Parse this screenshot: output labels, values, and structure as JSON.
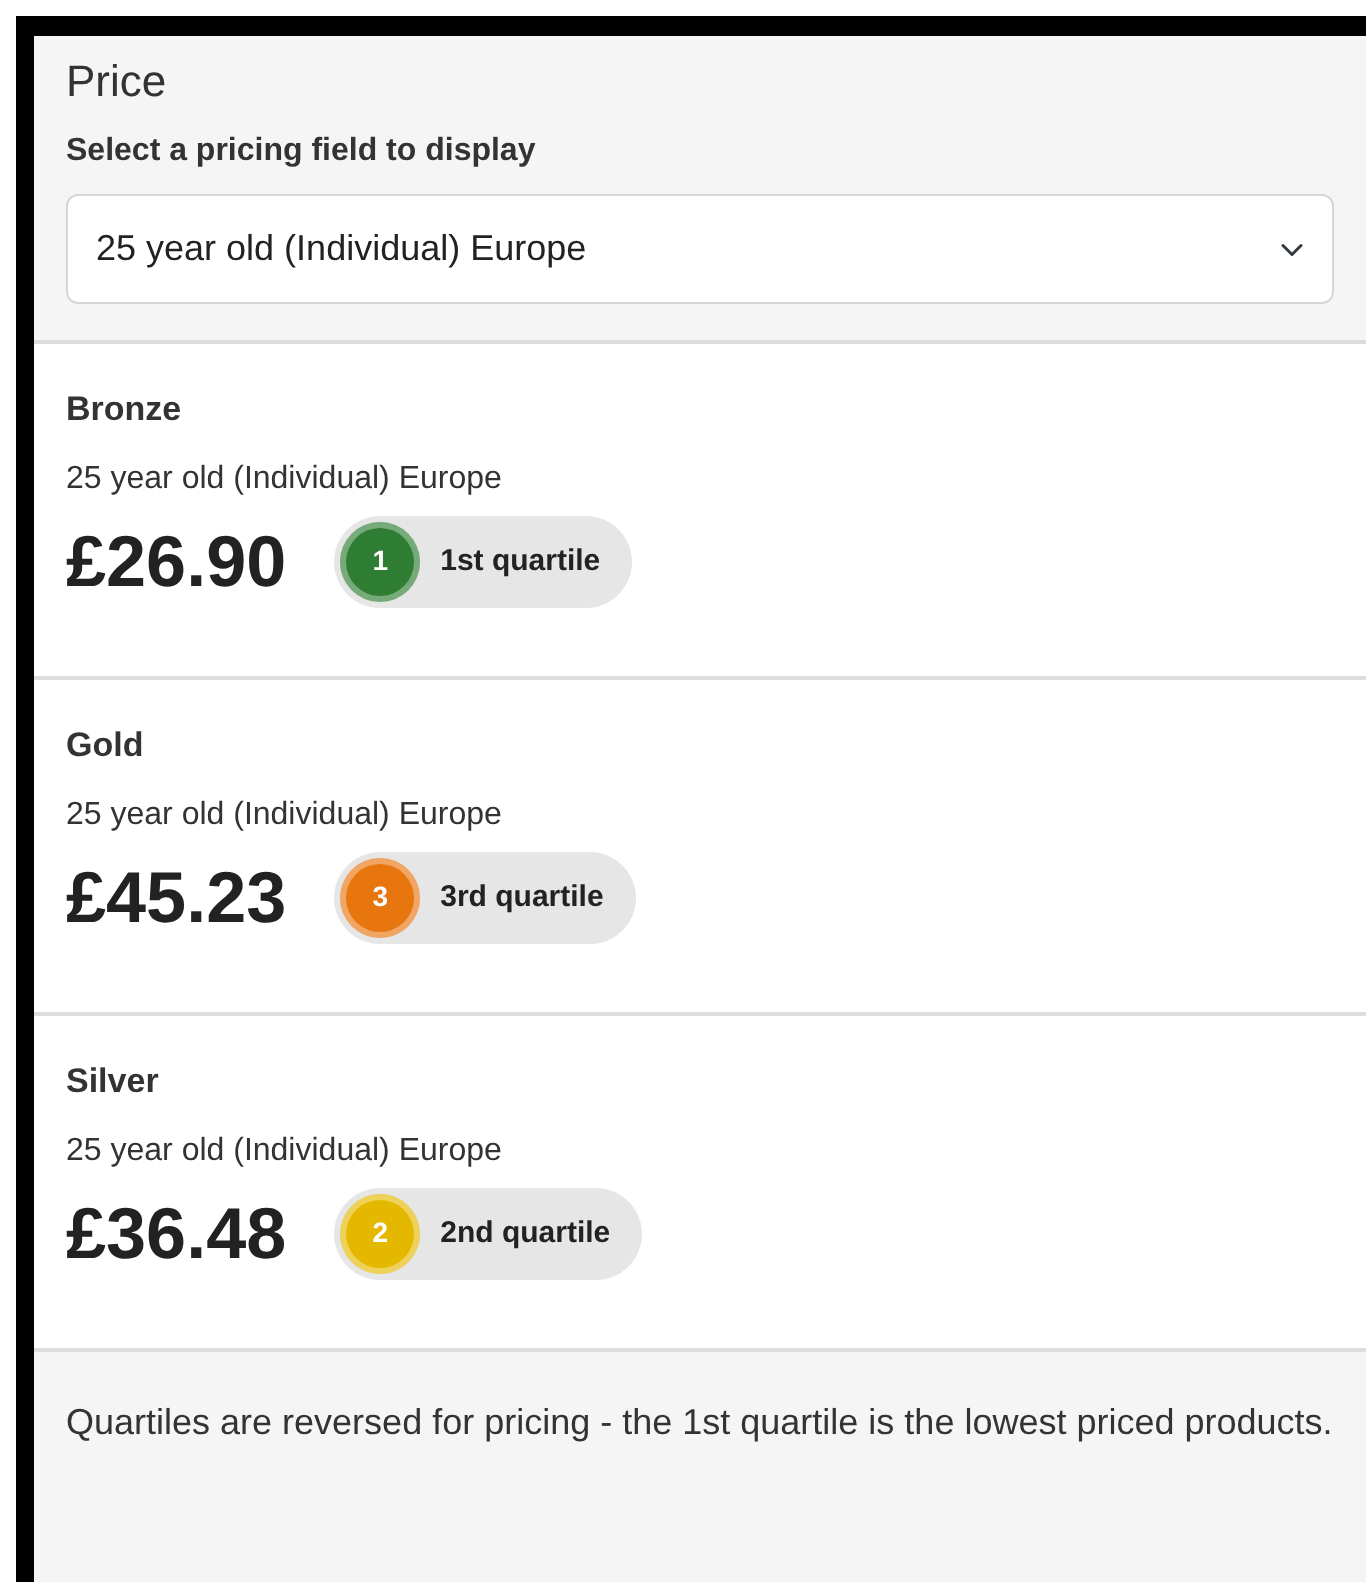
{
  "panel": {
    "title": "Price",
    "field_label": "Select a pricing field to display",
    "select": {
      "value": "25 year old (Individual) Europe"
    }
  },
  "products": [
    {
      "name": "Bronze",
      "field": "25 year old (Individual) Europe",
      "price": "£26.90",
      "quartile": "1",
      "quartile_label": "1st quartile",
      "color": "#2e7d32"
    },
    {
      "name": "Gold",
      "field": "25 year old (Individual) Europe",
      "price": "£45.23",
      "quartile": "3",
      "quartile_label": "3rd quartile",
      "color": "#e8760f"
    },
    {
      "name": "Silver",
      "field": "25 year old (Individual) Europe",
      "price": "£36.48",
      "quartile": "2",
      "quartile_label": "2nd quartile",
      "color": "#e5b800"
    }
  ],
  "footer": "Quartiles are reversed for pricing - the 1st quartile is the lowest priced products."
}
